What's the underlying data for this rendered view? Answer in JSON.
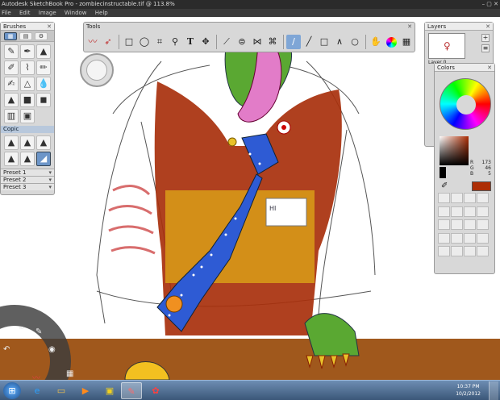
{
  "window": {
    "title": "Autodesk SketchBook Pro - zombiecinstructable.tif @ 113.8%",
    "controls": "–  ▢  ✕"
  },
  "menu": [
    "File",
    "Edit",
    "Image",
    "Window",
    "Help"
  ],
  "brushes_panel": {
    "title": "Brushes",
    "copic_label": "Copic",
    "presets": [
      "Preset 1",
      "Preset 2",
      "Preset 3"
    ]
  },
  "tools_panel": {
    "title": "Tools",
    "icons": [
      "brush-stroke-icon",
      "smudge-icon",
      "rectangle-select-icon",
      "lasso-icon",
      "crop-icon",
      "zoom-icon",
      "text-icon",
      "move-icon",
      "ruler-icon",
      "ellipse-guide-icon",
      "symmetry-icon",
      "symmetry-xy-icon",
      "line-curve-icon",
      "line-icon",
      "rectangle-icon",
      "polyline-icon",
      "circle-icon",
      "hand-icon",
      "color-wheel-icon",
      "layer-toggle-icon"
    ]
  },
  "layers_panel": {
    "title": "Layers",
    "layer_name": "Layer 0"
  },
  "colors_panel": {
    "title": "Colors",
    "r_label": "R",
    "r_value": "173",
    "g_label": "G",
    "g_value": "46",
    "b_label": "B",
    "b_value": "5",
    "current_color": "#ad2e05"
  },
  "taskbar": {
    "clock_time": "10:37 PM",
    "clock_date": "10/2/2012"
  },
  "colors": {
    "brush_selected": "#6c95c8",
    "vest": "#a8300c",
    "tie": "#2e5bd4",
    "stripe": "#d89a18",
    "skin": "#5aa832",
    "desk": "#a0581c"
  }
}
